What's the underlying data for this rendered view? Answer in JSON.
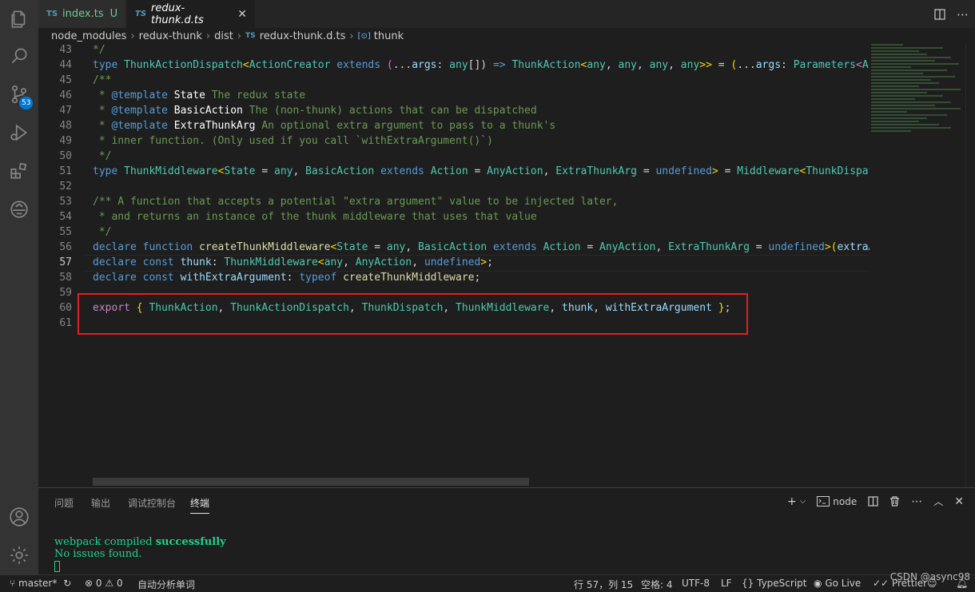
{
  "tabs": [
    {
      "badge": "TS",
      "label": "index.ts",
      "status": "U"
    },
    {
      "badge": "TS",
      "label": "redux-thunk.d.ts",
      "close": "✕"
    }
  ],
  "breadcrumb": {
    "parts": [
      "node_modules",
      "redux-thunk",
      "dist"
    ],
    "file_badge": "TS",
    "file": "redux-thunk.d.ts",
    "symbol": "thunk",
    "separator": "›"
  },
  "editor": {
    "line_numbers": [
      "43",
      "44",
      "45",
      "46",
      "47",
      "48",
      "49",
      "50",
      "51",
      "52",
      "53",
      "54",
      "55",
      "56",
      "57",
      "58",
      "59",
      "60",
      "61"
    ],
    "current_line": "57"
  },
  "activity": {
    "source_control_badge": "53"
  },
  "panel": {
    "tabs": [
      "问题",
      "输出",
      "调试控制台",
      "终端"
    ],
    "active_tab": "终端",
    "shell": "node",
    "terminal_line1_prefix": "webpack compiled ",
    "terminal_line1_highlight": "successfully",
    "terminal_line2": "No issues found."
  },
  "status": {
    "branch": "master*",
    "errors": "0",
    "warnings": "0",
    "task": "自动分析单词",
    "position": "行 57，列 15",
    "spaces": "空格: 4",
    "encoding": "UTF-8",
    "eol": "LF",
    "language": "TypeScript",
    "golive": "Go Live",
    "prettier": "Prettier"
  },
  "watermark": "CSDN @async98"
}
